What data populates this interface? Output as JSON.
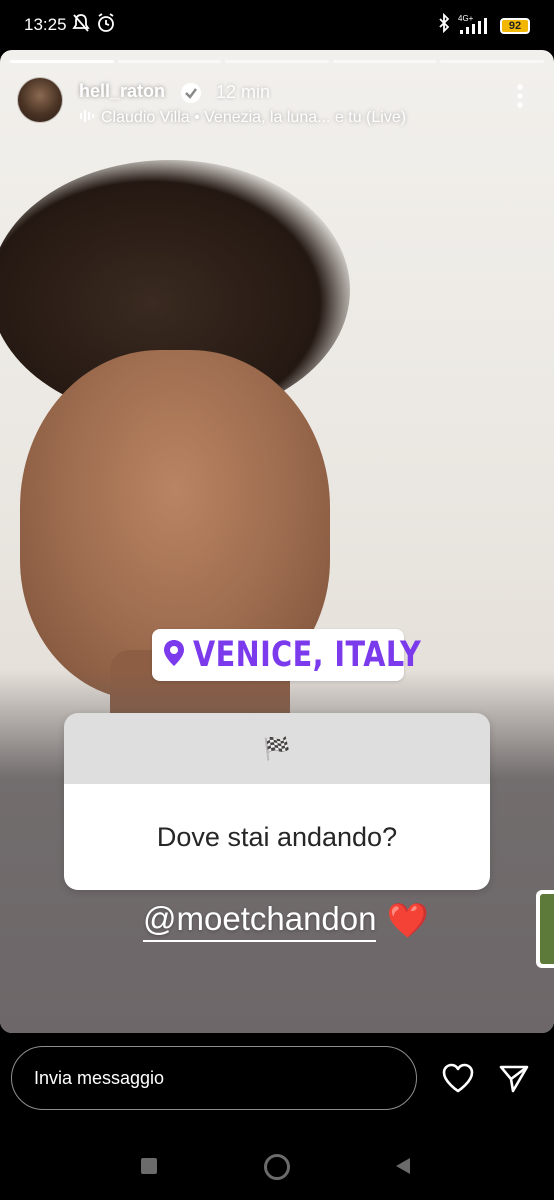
{
  "status_bar": {
    "time": "13:25",
    "network": "4G+",
    "battery": "92",
    "icons": [
      "mute-icon",
      "alarm-icon",
      "bluetooth-icon",
      "signal-icon",
      "battery-icon"
    ]
  },
  "story": {
    "username": "hell_raton",
    "verified": true,
    "time_ago": "12 min",
    "music": "Claudio Villa • Venezia, la luna... e tu (Live)",
    "segments_total": 5,
    "segments_seen": 1,
    "location_sticker": "VENICE, ITALY",
    "question_emoji": "🏁",
    "question_text": "Dove stai andando?",
    "mention": "@moetchandon",
    "mention_emoji": "❤️"
  },
  "footer": {
    "message_placeholder": "Invia messaggio"
  },
  "colors": {
    "location_purple": "#7c3aed",
    "battery_yellow": "#f2b705"
  }
}
